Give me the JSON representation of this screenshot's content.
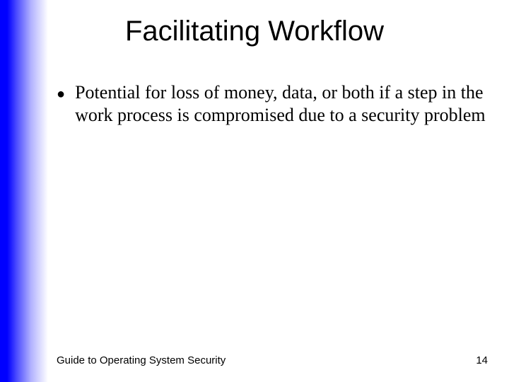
{
  "slide": {
    "title": "Facilitating Workflow",
    "bullets": [
      "Potential for loss of money, data, or both if a step in the work process is compromised due to a security problem"
    ],
    "footer_left": "Guide to Operating System Security",
    "page_number": "14"
  }
}
